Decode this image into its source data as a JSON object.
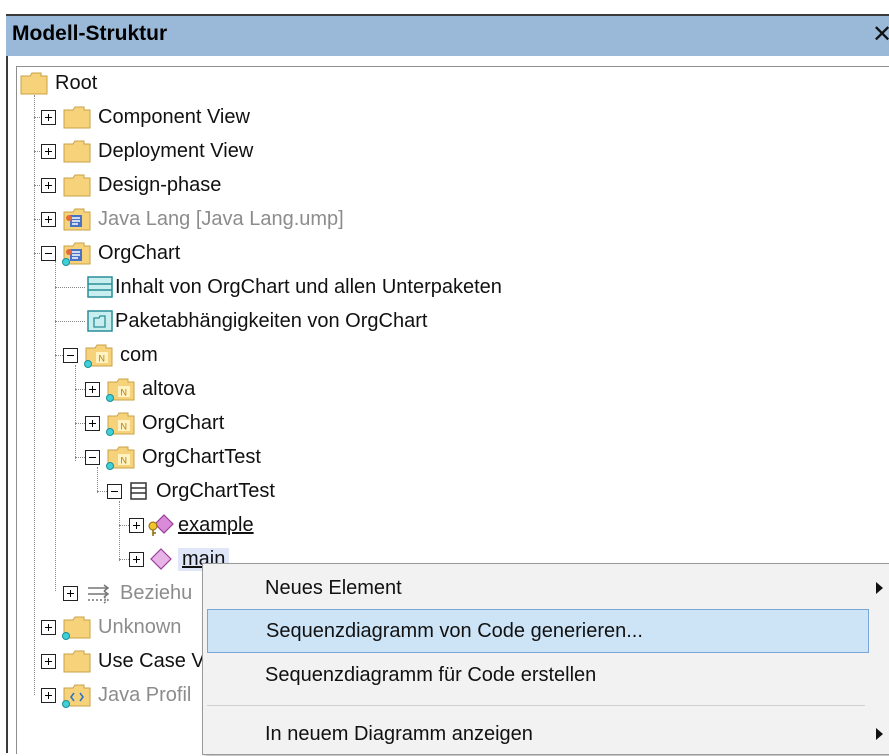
{
  "panel": {
    "title": "Modell-Struktur",
    "close_glyph": "✕"
  },
  "tree": [
    {
      "label": "Root",
      "icon": "folder-icon",
      "expander": "none",
      "style": "normal"
    },
    {
      "label": "Component View",
      "icon": "folder-icon",
      "expander": "plus",
      "style": "normal"
    },
    {
      "label": "Deployment View",
      "icon": "folder-icon",
      "expander": "plus",
      "style": "normal"
    },
    {
      "label": "Design-phase",
      "icon": "folder-icon",
      "expander": "plus",
      "style": "normal"
    },
    {
      "label": "Java Lang [Java Lang.ump]",
      "icon": "java-package-icon",
      "expander": "plus",
      "style": "gray"
    },
    {
      "label": "OrgChart",
      "icon": "java-package-icon",
      "expander": "minus",
      "style": "normal"
    },
    {
      "label": "Inhalt von OrgChart und allen Unterpaketen",
      "icon": "content-diagram-icon",
      "expander": "none",
      "style": "normal"
    },
    {
      "label": "Paketabhängigkeiten von OrgChart",
      "icon": "package-dependency-diagram-icon",
      "expander": "none",
      "style": "normal"
    },
    {
      "label": "com",
      "icon": "namespace-package-icon",
      "expander": "minus",
      "style": "normal"
    },
    {
      "label": "altova",
      "icon": "namespace-package-icon",
      "expander": "plus",
      "style": "normal"
    },
    {
      "label": "OrgChart",
      "icon": "namespace-package-icon",
      "expander": "plus",
      "style": "normal"
    },
    {
      "label": "OrgChartTest",
      "icon": "namespace-package-icon",
      "expander": "minus",
      "style": "normal"
    },
    {
      "label": "OrgChartTest",
      "icon": "class-icon",
      "expander": "minus",
      "style": "normal"
    },
    {
      "label": "example",
      "icon": "operation-key-icon",
      "expander": "plus",
      "style": "link"
    },
    {
      "label": "main",
      "icon": "operation-icon",
      "expander": "plus",
      "style": "link-selected"
    },
    {
      "label": "Beziehu",
      "icon": "relations-icon",
      "expander": "plus",
      "style": "gray"
    },
    {
      "label": "Unknown",
      "icon": "folder-icon",
      "expander": "plus",
      "style": "gray"
    },
    {
      "label": "Use Case V",
      "icon": "folder-icon",
      "expander": "plus",
      "style": "normal"
    },
    {
      "label": "Java Profil",
      "icon": "java-profile-icon",
      "expander": "plus",
      "style": "gray"
    }
  ],
  "context_menu": {
    "items": [
      {
        "label": "Neues Element",
        "submenu": true
      },
      {
        "label": "Sequenzdiagramm von Code generieren...",
        "submenu": false
      },
      {
        "label": "Sequenzdiagramm für Code erstellen",
        "submenu": false
      },
      {
        "label": "In neuem Diagramm anzeigen",
        "submenu": true
      }
    ]
  },
  "colors": {
    "title_bar": "#9ab9d8",
    "menu_hover": "#cde4f7",
    "selection": "#dfe6f7"
  }
}
